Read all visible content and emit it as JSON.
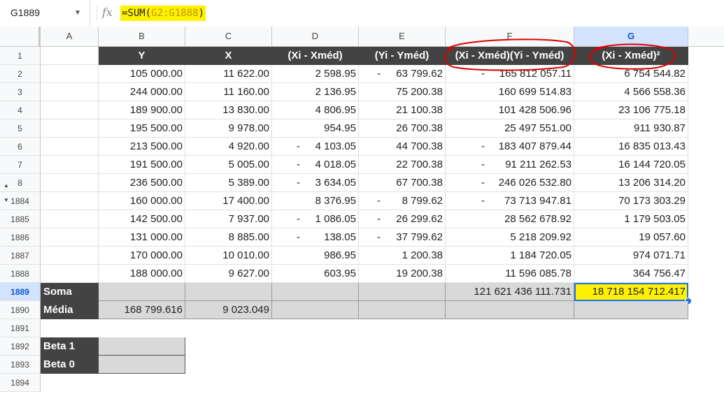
{
  "formula_bar": {
    "name_box": "G1889",
    "fx_label": "fx",
    "formula_prefix": "=SUM(",
    "formula_range": "G2:G1888",
    "formula_suffix": ")"
  },
  "columns": [
    "A",
    "B",
    "C",
    "D",
    "E",
    "F",
    "G"
  ],
  "header_row": {
    "row_num": "1",
    "B": "Y",
    "C": "X",
    "D": "(Xi - Xméd)",
    "E": "(Yi - Yméd)",
    "F": "(Xi - Xméd)(Yi - Yméd)",
    "G": "(Xi - Xméd)²"
  },
  "data_rows": [
    {
      "row": "2",
      "B": "105 000.00",
      "C": "11 622.00",
      "D": "2 598.95",
      "E": "63 799.62",
      "E_neg": true,
      "F": "165 812 057.11",
      "F_neg": true,
      "G": "6 754 544.82"
    },
    {
      "row": "3",
      "B": "244 000.00",
      "C": "11 160.00",
      "D": "2 136.95",
      "E": "75 200.38",
      "F": "160 699 514.83",
      "G": "4 566 558.36"
    },
    {
      "row": "4",
      "B": "189 900.00",
      "C": "13 830.00",
      "D": "4 806.95",
      "E": "21 100.38",
      "F": "101 428 506.96",
      "G": "23 106 775.18"
    },
    {
      "row": "5",
      "B": "195 500.00",
      "C": "9 978.00",
      "D": "954.95",
      "E": "26 700.38",
      "F": "25 497 551.00",
      "G": "911 930.87"
    },
    {
      "row": "6",
      "B": "213 500.00",
      "C": "4 920.00",
      "D": "4 103.05",
      "D_neg": true,
      "E": "44 700.38",
      "F": "183 407 879.44",
      "F_neg": true,
      "G": "16 835 013.43"
    },
    {
      "row": "7",
      "B": "191 500.00",
      "C": "5 005.00",
      "D": "4 018.05",
      "D_neg": true,
      "E": "22 700.38",
      "F": "91 211 262.53",
      "F_neg": true,
      "G": "16 144 720.05"
    },
    {
      "row": "8",
      "B": "236 500.00",
      "C": "5 389.00",
      "D": "3 634.05",
      "D_neg": true,
      "E": "67 700.38",
      "F": "246 026 532.80",
      "F_neg": true,
      "G": "13 206 314.20"
    },
    {
      "row": "1884",
      "B": "160 000.00",
      "C": "17 400.00",
      "D": "8 376.95",
      "E": "8 799.62",
      "E_neg": true,
      "F": "73 713 947.81",
      "F_neg": true,
      "G": "70 173 303.29"
    },
    {
      "row": "1885",
      "B": "142 500.00",
      "C": "7 937.00",
      "D": "1 086.05",
      "D_neg": true,
      "E": "26 299.62",
      "E_neg": true,
      "F": "28 562 678.92",
      "G": "1 179 503.05"
    },
    {
      "row": "1886",
      "B": "131 000.00",
      "C": "8 885.00",
      "D": "138.05",
      "D_neg": true,
      "E": "37 799.62",
      "E_neg": true,
      "F": "5 218 209.92",
      "G": "19 057.60"
    },
    {
      "row": "1887",
      "B": "170 000.00",
      "C": "10 010.00",
      "D": "986.95",
      "E": "1 200.38",
      "F": "1 184 720.05",
      "G": "974 071.71"
    },
    {
      "row": "1888",
      "B": "188 000.00",
      "C": "9 627.00",
      "D": "603.95",
      "E": "19 200.38",
      "F": "11 596 085.78",
      "G": "364 756.47"
    }
  ],
  "soma_row": {
    "row": "1889",
    "label": "Soma",
    "F": "121 621 436 111.731",
    "G": "18 718 154 712.417"
  },
  "media_row": {
    "row": "1890",
    "label": "Média",
    "B": "168 799.616",
    "C": "9 023.049"
  },
  "empty_row_1891": "1891",
  "beta1_row": {
    "row": "1892",
    "label": "Beta 1"
  },
  "beta0_row": {
    "row": "1893",
    "label": "Beta 0"
  },
  "empty_row_1894": "1894",
  "neg_sign": "-",
  "colors": {
    "header_dark": "#434343",
    "highlight": "#fff200",
    "selection": "#1a73e8",
    "annotation": "#e00000",
    "gray_cell": "#d9d9d9"
  },
  "icons": [
    "dropdown-arrow-icon",
    "fx-icon",
    "expand-rows-icon",
    "collapse-rows-icon"
  ]
}
